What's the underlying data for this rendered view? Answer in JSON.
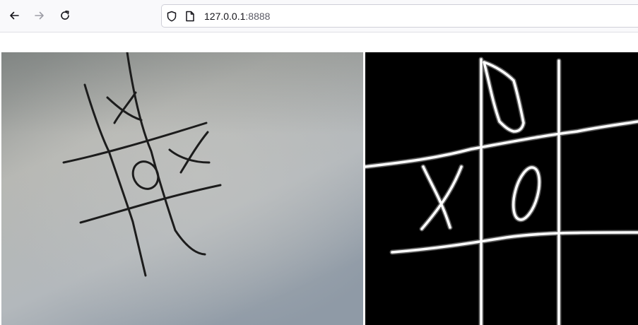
{
  "browser": {
    "url_host": "127.0.0.1",
    "url_port": ":8888",
    "icons": {
      "back": "back-arrow-icon",
      "forward": "forward-arrow-icon",
      "reload": "reload-icon",
      "shield": "tracking-protection-shield-icon",
      "page": "page-info-icon"
    }
  },
  "content": {
    "camera_image": {
      "description_icon": "camera-feed-image",
      "board": {
        "cells": [
          [
            "",
            "X",
            ""
          ],
          [
            "",
            "O",
            "X"
          ],
          [
            "",
            "",
            ""
          ]
        ]
      }
    },
    "processed_image": {
      "description_icon": "thresholded-edge-image",
      "board": {
        "cells": [
          [
            "",
            "",
            ""
          ],
          [
            "X",
            "O",
            ""
          ],
          [
            "",
            "",
            ""
          ]
        ]
      }
    }
  },
  "colors": {
    "toolbar_bg": "#f9f9fb",
    "paper_light": "#b9bcbf",
    "paper_dark": "#7e8488",
    "ink": "#1a1a1a",
    "mask_bg": "#000000",
    "mask_line": "#ffffff"
  }
}
